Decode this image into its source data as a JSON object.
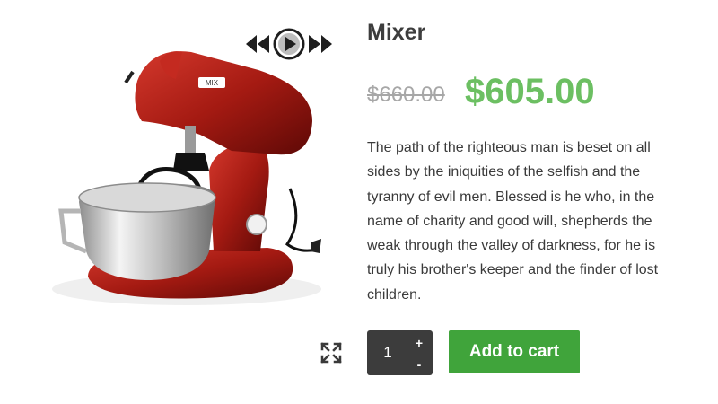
{
  "product": {
    "name": "Mixer",
    "old_price": "$660.00",
    "price": "$605.00",
    "description": "The path of the righteous man is beset on all sides by the iniquities of the selfish and the tyranny of evil men. Blessed is he who, in the name of charity and good will, shepherds the weak through the valley of darkness, for he is truly his brother's keeper and the finder of lost children.",
    "image_badge": "MIX"
  },
  "cart": {
    "quantity": "1",
    "plus_label": "+",
    "minus_label": "-",
    "add_label": "Add to cart"
  },
  "gallery": {
    "icons": [
      "rewind-icon",
      "play-icon",
      "fast-forward-icon",
      "fullscreen-icon"
    ]
  },
  "colors": {
    "price": "#6cbf62",
    "add_button": "#40a43b",
    "quantity_box": "#3c3c3c",
    "old_price": "#a7a7a7",
    "mixer_body": "#a41a12"
  }
}
